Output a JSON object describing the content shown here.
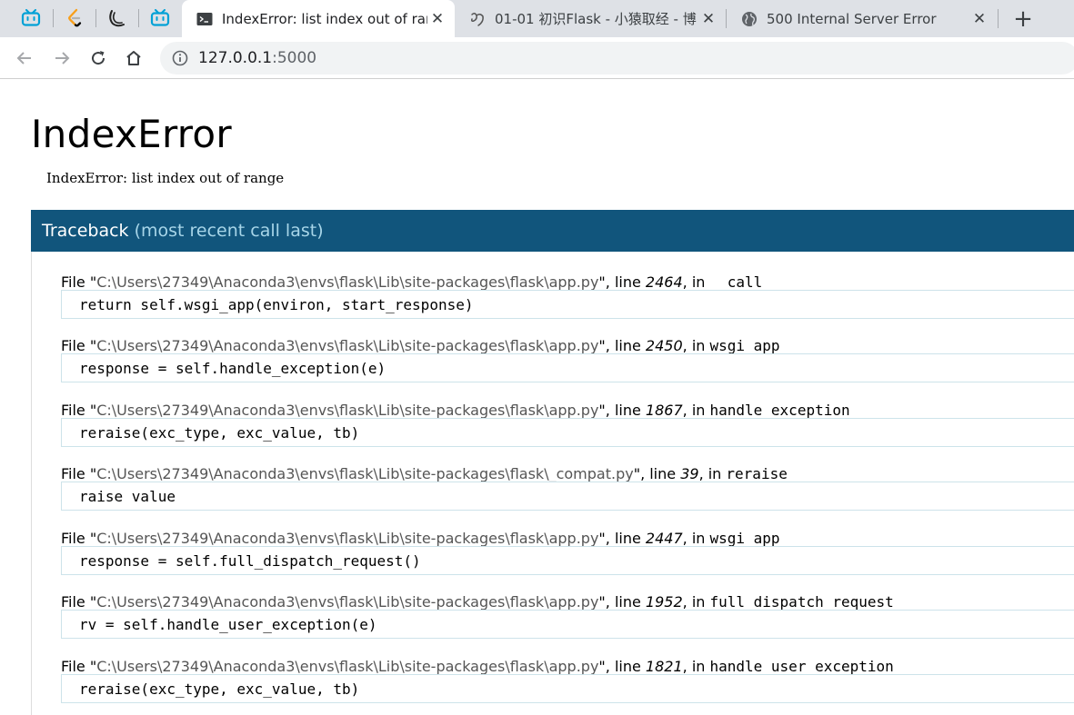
{
  "browser": {
    "pinned_tabs": [
      {
        "icon": "bilibili-icon"
      },
      {
        "icon": "leetcode-icon"
      },
      {
        "icon": "moon-icon"
      },
      {
        "icon": "bilibili-icon"
      }
    ],
    "tabs": [
      {
        "title": "IndexError: list index out of range",
        "icon": "terminal-icon",
        "close": "✕",
        "active": true
      },
      {
        "title": "01-01 初识Flask - 小猿取经 - 博",
        "icon": "fly-icon",
        "close": "✕",
        "active": false
      },
      {
        "title": "500 Internal Server Error",
        "icon": "globe-icon",
        "close": "✕",
        "active": false
      }
    ],
    "new_tab": "+",
    "url_host": "127.0.0.1",
    "url_port": ":5000"
  },
  "page": {
    "error_title": "IndexError",
    "error_message": "IndexError: list index out of range",
    "traceback_label": "Traceback",
    "traceback_sub": "(most recent call last)",
    "frames": [
      {
        "file_prefix": "File \"",
        "filename": "C:\\Users\\27349\\Anaconda3\\envs\\flask\\Lib\\site-packages\\flask\\app.py",
        "mid": "\", line ",
        "line": "2464",
        "in": ", in ",
        "func": "__call__",
        "code": "return self.wsgi_app(environ, start_response)"
      },
      {
        "file_prefix": "File \"",
        "filename": "C:\\Users\\27349\\Anaconda3\\envs\\flask\\Lib\\site-packages\\flask\\app.py",
        "mid": "\", line ",
        "line": "2450",
        "in": ", in ",
        "func": "wsgi_app",
        "code": "response = self.handle_exception(e)"
      },
      {
        "file_prefix": "File \"",
        "filename": "C:\\Users\\27349\\Anaconda3\\envs\\flask\\Lib\\site-packages\\flask\\app.py",
        "mid": "\", line ",
        "line": "1867",
        "in": ", in ",
        "func": "handle_exception",
        "code": "reraise(exc_type, exc_value, tb)"
      },
      {
        "file_prefix": "File \"",
        "filename": "C:\\Users\\27349\\Anaconda3\\envs\\flask\\Lib\\site-packages\\flask\\_compat.py",
        "mid": "\", line ",
        "line": "39",
        "in": ", in ",
        "func": "reraise",
        "code": "raise value"
      },
      {
        "file_prefix": "File \"",
        "filename": "C:\\Users\\27349\\Anaconda3\\envs\\flask\\Lib\\site-packages\\flask\\app.py",
        "mid": "\", line ",
        "line": "2447",
        "in": ", in ",
        "func": "wsgi_app",
        "code": "response = self.full_dispatch_request()"
      },
      {
        "file_prefix": "File \"",
        "filename": "C:\\Users\\27349\\Anaconda3\\envs\\flask\\Lib\\site-packages\\flask\\app.py",
        "mid": "\", line ",
        "line": "1952",
        "in": ", in ",
        "func": "full_dispatch_request",
        "code": "rv = self.handle_user_exception(e)"
      },
      {
        "file_prefix": "File \"",
        "filename": "C:\\Users\\27349\\Anaconda3\\envs\\flask\\Lib\\site-packages\\flask\\app.py",
        "mid": "\", line ",
        "line": "1821",
        "in": ", in ",
        "func": "handle_user_exception",
        "code": "reraise(exc_type, exc_value, tb)"
      }
    ]
  },
  "colors": {
    "traceback_header_bg": "#11557c",
    "traceback_header_sub": "#a7d5e8",
    "tab_strip_bg": "#dee1e6"
  }
}
